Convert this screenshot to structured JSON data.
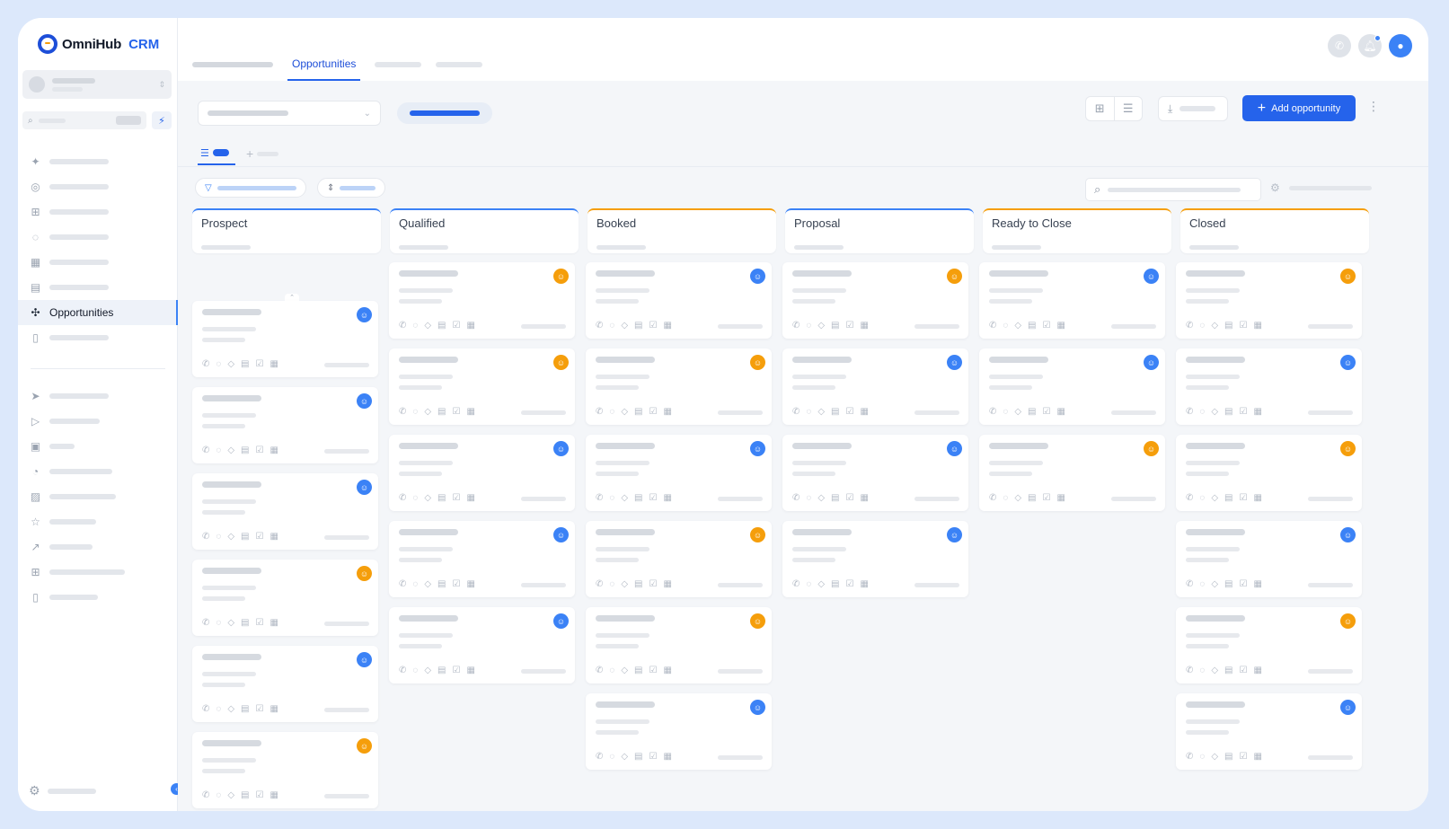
{
  "brand": {
    "name": "OmniHub",
    "suffix": "CRM"
  },
  "sidebar": {
    "active_item": {
      "label": "Opportunities",
      "icon": "opportunities-icon"
    },
    "icons_top": [
      "sparkle-icon",
      "dashboard-icon",
      "grid-icon",
      "chat-icon",
      "calendar-icon",
      "contacts-icon",
      "opportunities-icon",
      "payments-icon"
    ],
    "icons_bottom": [
      "send-icon",
      "play-icon",
      "calendar-badge-icon",
      "medal-icon",
      "image-icon",
      "star-icon",
      "trend-icon",
      "apps-icon",
      "mobile-icon"
    ],
    "settings_icon": "gear-icon"
  },
  "header": {
    "active_tab": "Opportunities"
  },
  "toolbar": {
    "add_label": "Add opportunity"
  },
  "board": {
    "columns": [
      {
        "title": "Prospect",
        "accent": "#3b82f6",
        "owners": [
          "blue",
          "blue",
          "blue",
          "amber",
          "blue",
          "amber"
        ]
      },
      {
        "title": "Qualified",
        "accent": "#3b82f6",
        "owners": [
          "amber",
          "amber",
          "blue",
          "blue",
          "blue"
        ]
      },
      {
        "title": "Booked",
        "accent": "#f59e0b",
        "owners": [
          "blue",
          "amber",
          "blue",
          "amber",
          "amber",
          "blue"
        ]
      },
      {
        "title": "Proposal",
        "accent": "#3b82f6",
        "owners": [
          "amber",
          "blue",
          "blue",
          "blue"
        ]
      },
      {
        "title": "Ready to Close",
        "accent": "#f59e0b",
        "owners": [
          "blue",
          "blue",
          "amber"
        ]
      },
      {
        "title": "Closed",
        "accent": "#f59e0b",
        "owners": [
          "amber",
          "blue",
          "amber",
          "blue",
          "amber",
          "blue"
        ]
      }
    ]
  },
  "colors": {
    "primary": "#2563eb",
    "owner_blue": "#3b82f6",
    "owner_amber": "#f59e0b"
  }
}
